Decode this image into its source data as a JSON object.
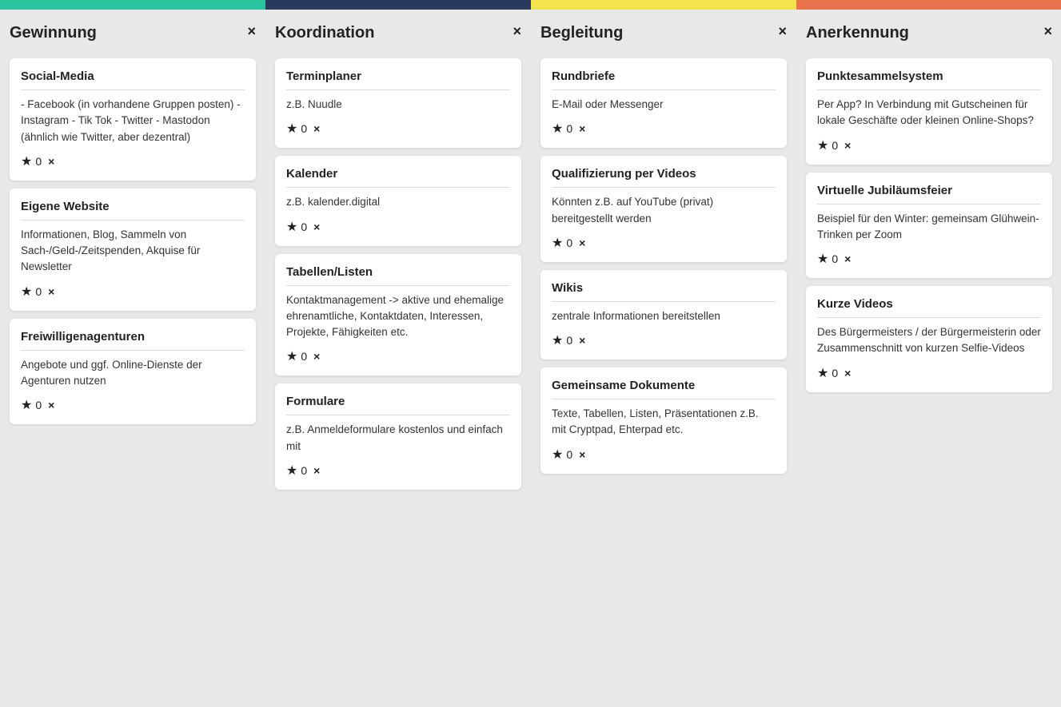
{
  "columns": [
    {
      "id": "gewinnung",
      "color_class": "col-gewinnung",
      "title": "Gewinnung",
      "cards": [
        {
          "title": "Social-Media",
          "body": "- Facebook (in vorhandene Gruppen posten) - Instagram - Tik Tok - Twitter - Mastodon (ähnlich wie Twitter, aber dezentral)",
          "stars": 0
        },
        {
          "title": "Eigene Website",
          "body": "Informationen, Blog, Sammeln von Sach-/Geld-/Zeitspenden, Akquise für Newsletter",
          "stars": 0
        },
        {
          "title": "Freiwilligenagenturen",
          "body": "Angebote und ggf. Online-Dienste der Agenturen nutzen",
          "stars": 0
        }
      ]
    },
    {
      "id": "koordination",
      "color_class": "col-koordination",
      "title": "Koordination",
      "cards": [
        {
          "title": "Terminplaner",
          "body": "z.B. Nuudle",
          "stars": 0
        },
        {
          "title": "Kalender",
          "body": "z.B. kalender.digital",
          "stars": 0
        },
        {
          "title": "Tabellen/Listen",
          "body": "Kontaktmanagement -> aktive und ehemalige ehrenamtliche, Kontaktdaten, Interessen, Projekte, Fähigkeiten etc.",
          "stars": 0
        },
        {
          "title": "Formulare",
          "body": "z.B. Anmeldeformulare kostenlos und einfach mit",
          "stars": 0
        }
      ]
    },
    {
      "id": "begleitung",
      "color_class": "col-begleitung",
      "title": "Begleitung",
      "cards": [
        {
          "title": "Rundbriefe",
          "body": "E-Mail oder Messenger",
          "stars": 0
        },
        {
          "title": "Qualifizierung per Videos",
          "body": "Könnten z.B. auf YouTube (privat) bereitgestellt werden",
          "stars": 0
        },
        {
          "title": "Wikis",
          "body": "zentrale Informationen bereitstellen",
          "stars": 0
        },
        {
          "title": "Gemeinsame Dokumente",
          "body": "Texte, Tabellen, Listen, Präsentationen z.B. mit Cryptpad, Ehterpad etc.",
          "stars": 0
        }
      ]
    },
    {
      "id": "anerkennung",
      "color_class": "col-anerkennung",
      "title": "Anerkennung",
      "cards": [
        {
          "title": "Punktesammelsystem",
          "body": "Per App? In Verbindung mit Gutscheinen für lokale Geschäfte oder kleinen Online-Shops?",
          "stars": 0
        },
        {
          "title": "Virtuelle Jubiläumsfeier",
          "body": "Beispiel für den Winter: gemeinsam Glühwein-Trinken per Zoom",
          "stars": 0
        },
        {
          "title": "Kurze Videos",
          "body": "Des Bürgermeisters / der Bürgermeisterin oder Zusammenschnitt von kurzen Selfie-Videos",
          "stars": 0
        }
      ]
    }
  ],
  "labels": {
    "close": "×",
    "star_label": "0"
  }
}
